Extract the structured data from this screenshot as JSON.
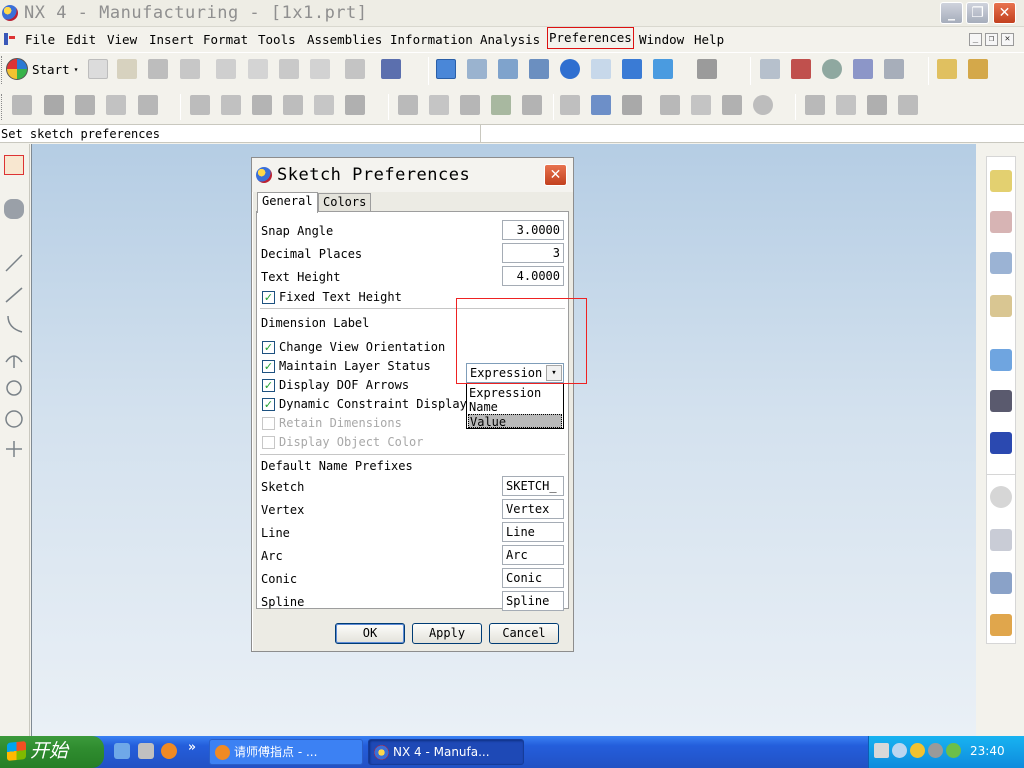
{
  "window": {
    "title": "NX 4 - Manufacturing - [1x1.prt]",
    "controls": {
      "minimize": "_",
      "maximize": "❐",
      "close": "✕"
    }
  },
  "menubar": {
    "items": [
      "File",
      "Edit",
      "View",
      "Insert",
      "Format",
      "Tools",
      "Assemblies",
      "Information",
      "Analysis",
      "Preferences",
      "Window",
      "Help"
    ],
    "active": "Preferences",
    "mdi_controls": {
      "minimize": "_",
      "restore": "❐",
      "close": "✕"
    }
  },
  "toolbar": {
    "start_label": "Start",
    "dropdown_arrow": "▾"
  },
  "status": {
    "message": "Set sketch preferences"
  },
  "dialog": {
    "title": "Sketch Preferences",
    "close": "✕",
    "tabs": [
      "General",
      "Colors"
    ],
    "active_tab": "General",
    "snap_angle": {
      "label": "Snap Angle",
      "value": "3.0000"
    },
    "decimal_places": {
      "label": "Decimal Places",
      "value": "3"
    },
    "text_height": {
      "label": "Text Height",
      "value": "4.0000"
    },
    "fixed_text_height": {
      "label": "Fixed Text Height",
      "checked": true
    },
    "dimension_label": {
      "label": "Dimension Label",
      "value": "Expression",
      "arrow": "▾",
      "options": [
        "Expression",
        "Name",
        "Value"
      ],
      "highlighted": "Value"
    },
    "checkboxes": [
      {
        "label": "Change View Orientation",
        "checked": true,
        "enabled": true
      },
      {
        "label": "Maintain Layer Status",
        "checked": true,
        "enabled": true
      },
      {
        "label": "Display DOF Arrows",
        "checked": true,
        "enabled": true
      },
      {
        "label": "Dynamic Constraint Display",
        "checked": true,
        "enabled": true
      },
      {
        "label": "Retain Dimensions",
        "checked": false,
        "enabled": false
      },
      {
        "label": "Display Object Color",
        "checked": false,
        "enabled": false
      }
    ],
    "check_mark": "✓",
    "prefixes_header": "Default Name Prefixes",
    "prefixes": [
      {
        "label": "Sketch",
        "value": "SKETCH_"
      },
      {
        "label": "Vertex",
        "value": "Vertex"
      },
      {
        "label": "Line",
        "value": "Line"
      },
      {
        "label": "Arc",
        "value": "Arc"
      },
      {
        "label": "Conic",
        "value": "Conic"
      },
      {
        "label": "Spline",
        "value": "Spline"
      }
    ],
    "buttons": {
      "ok": "OK",
      "apply": "Apply",
      "cancel": "Cancel"
    }
  },
  "taskbar": {
    "start_label": "开始",
    "quick_more": "»",
    "tasks": [
      {
        "label": "请师傅指点 - ...",
        "active": false
      },
      {
        "label": "NX 4 - Manufa...",
        "active": true
      }
    ],
    "clock": "23:40"
  },
  "colors": {
    "highlight_red": "#e22222",
    "check_green": "#22a032",
    "canvas_top": "#b5cde4",
    "taskbar_blue": "#245edb"
  }
}
